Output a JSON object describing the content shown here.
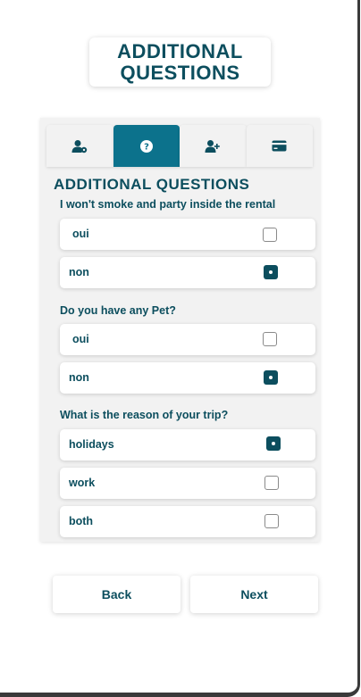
{
  "header": {
    "title": "ADDITIONAL QUESTIONS"
  },
  "tabs": [
    {
      "icon": "user-gear-icon",
      "active": false
    },
    {
      "icon": "question-circle-icon",
      "active": true
    },
    {
      "icon": "user-plus-icon",
      "active": false
    },
    {
      "icon": "credit-card-icon",
      "active": false
    }
  ],
  "colors": {
    "accent": "#0c728c",
    "text": "#0c4e5e",
    "panel": "#f2f2f2"
  },
  "section_title": "ADDITIONAL QUESTIONS",
  "questions": [
    {
      "text": "I won't smoke and party inside the rental",
      "options": [
        {
          "label": "oui",
          "checked": false
        },
        {
          "label": "non",
          "checked": true
        }
      ]
    },
    {
      "text": "Do you have any Pet?",
      "options": [
        {
          "label": "oui",
          "checked": false
        },
        {
          "label": "non",
          "checked": true
        }
      ]
    },
    {
      "text": "What is the reason of your trip?",
      "options": [
        {
          "label": "holidays",
          "checked": true
        },
        {
          "label": "work",
          "checked": false
        },
        {
          "label": "both",
          "checked": false
        }
      ]
    }
  ],
  "buttons": {
    "back": "Back",
    "next": "Next"
  }
}
